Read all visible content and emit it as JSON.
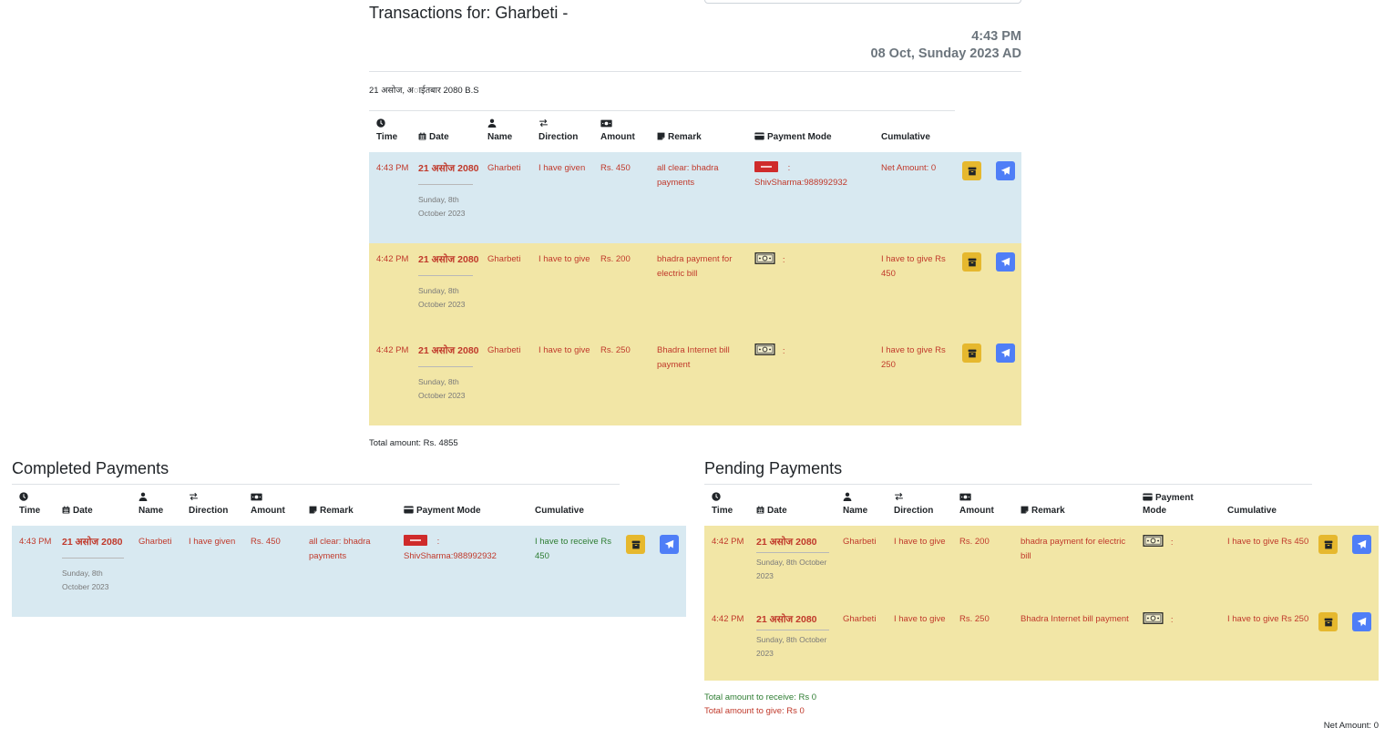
{
  "header": {
    "title": "Transactions for: Gharbeti -",
    "time": "4:43 PM",
    "date_ad": "08 Oct, Sunday 2023 AD",
    "date_bs": "21 असोज, अ◌ाईतबार 2080 B.S"
  },
  "columns": {
    "time": "Time",
    "date": "Date",
    "name": "Name",
    "direction": "Direction",
    "amount": "Amount",
    "remark": "Remark",
    "payment_mode": "Payment Mode",
    "payment_mode_l1": "Payment",
    "payment_mode_l2": "Mode",
    "cumulative": "Cumulative"
  },
  "main_table": {
    "rows": [
      {
        "time": "4:43 PM",
        "date_np": "21 असोज 2080",
        "date_en": "Sunday, 8th October 2023",
        "name": "Gharbeti",
        "direction": "I have given",
        "amount": "Rs. 450",
        "remark": "all clear: bhadra payments",
        "mode_icon": "bank-logo-icon",
        "mode_text": ":",
        "mode_detail": "ShivSharma:988992932",
        "cumulative": "Net Amount: 0"
      },
      {
        "time": "4:42 PM",
        "date_np": "21 असोज 2080",
        "date_en": "Sunday, 8th October 2023",
        "name": "Gharbeti",
        "direction": "I have to give",
        "amount": "Rs. 200",
        "remark": "bhadra payment for electric bill",
        "mode_icon": "cash-icon",
        "mode_text": ":",
        "cumulative": "I have to give Rs 450"
      },
      {
        "time": "4:42 PM",
        "date_np": "21 असोज 2080",
        "date_en": "Sunday, 8th October 2023",
        "name": "Gharbeti",
        "direction": "I have to give",
        "amount": "Rs. 250",
        "remark": "Bhadra Internet bill payment",
        "mode_icon": "cash-icon",
        "mode_text": ":",
        "cumulative": "I have to give Rs 250"
      }
    ],
    "total": "Total amount: Rs. 4855"
  },
  "completed": {
    "title": "Completed Payments",
    "rows": [
      {
        "time": "4:43 PM",
        "date_np": "21 असोज 2080",
        "date_en": "Sunday, 8th October 2023",
        "name": "Gharbeti",
        "direction": "I have given",
        "amount": "Rs. 450",
        "remark": "all clear: bhadra payments",
        "mode_icon": "bank-logo-icon",
        "mode_text": ":",
        "mode_detail": "ShivSharma:988992932",
        "cumulative": "I have to receive Rs 450"
      }
    ]
  },
  "pending": {
    "title": "Pending Payments",
    "rows": [
      {
        "time": "4:42 PM",
        "date_np": "21 असोज 2080",
        "date_en": "Sunday, 8th October 2023",
        "name": "Gharbeti",
        "direction": "I have to give",
        "amount": "Rs. 200",
        "remark": "bhadra payment for electric bill",
        "mode_icon": "cash-icon",
        "mode_text": ":",
        "cumulative": "I have to give Rs 450"
      },
      {
        "time": "4:42 PM",
        "date_np": "21 असोज 2080",
        "date_en": "Sunday, 8th October 2023",
        "name": "Gharbeti",
        "direction": "I have to give",
        "amount": "Rs. 250",
        "remark": "Bhadra Internet bill payment",
        "mode_icon": "cash-icon",
        "mode_text": ":",
        "cumulative": "I have to give Rs 250"
      }
    ],
    "to_receive": "Total amount to receive: Rs 0",
    "to_give": "Total amount to give: Rs 0",
    "net": "Net Amount: 0"
  },
  "colors": {
    "completed_row": "#d8e9f1",
    "pending_row": "#f2e6a6",
    "text_red": "#c0392b",
    "text_green": "#2e7d32",
    "archive_button": "#e6b82e",
    "send_button": "#4f7ef7"
  }
}
